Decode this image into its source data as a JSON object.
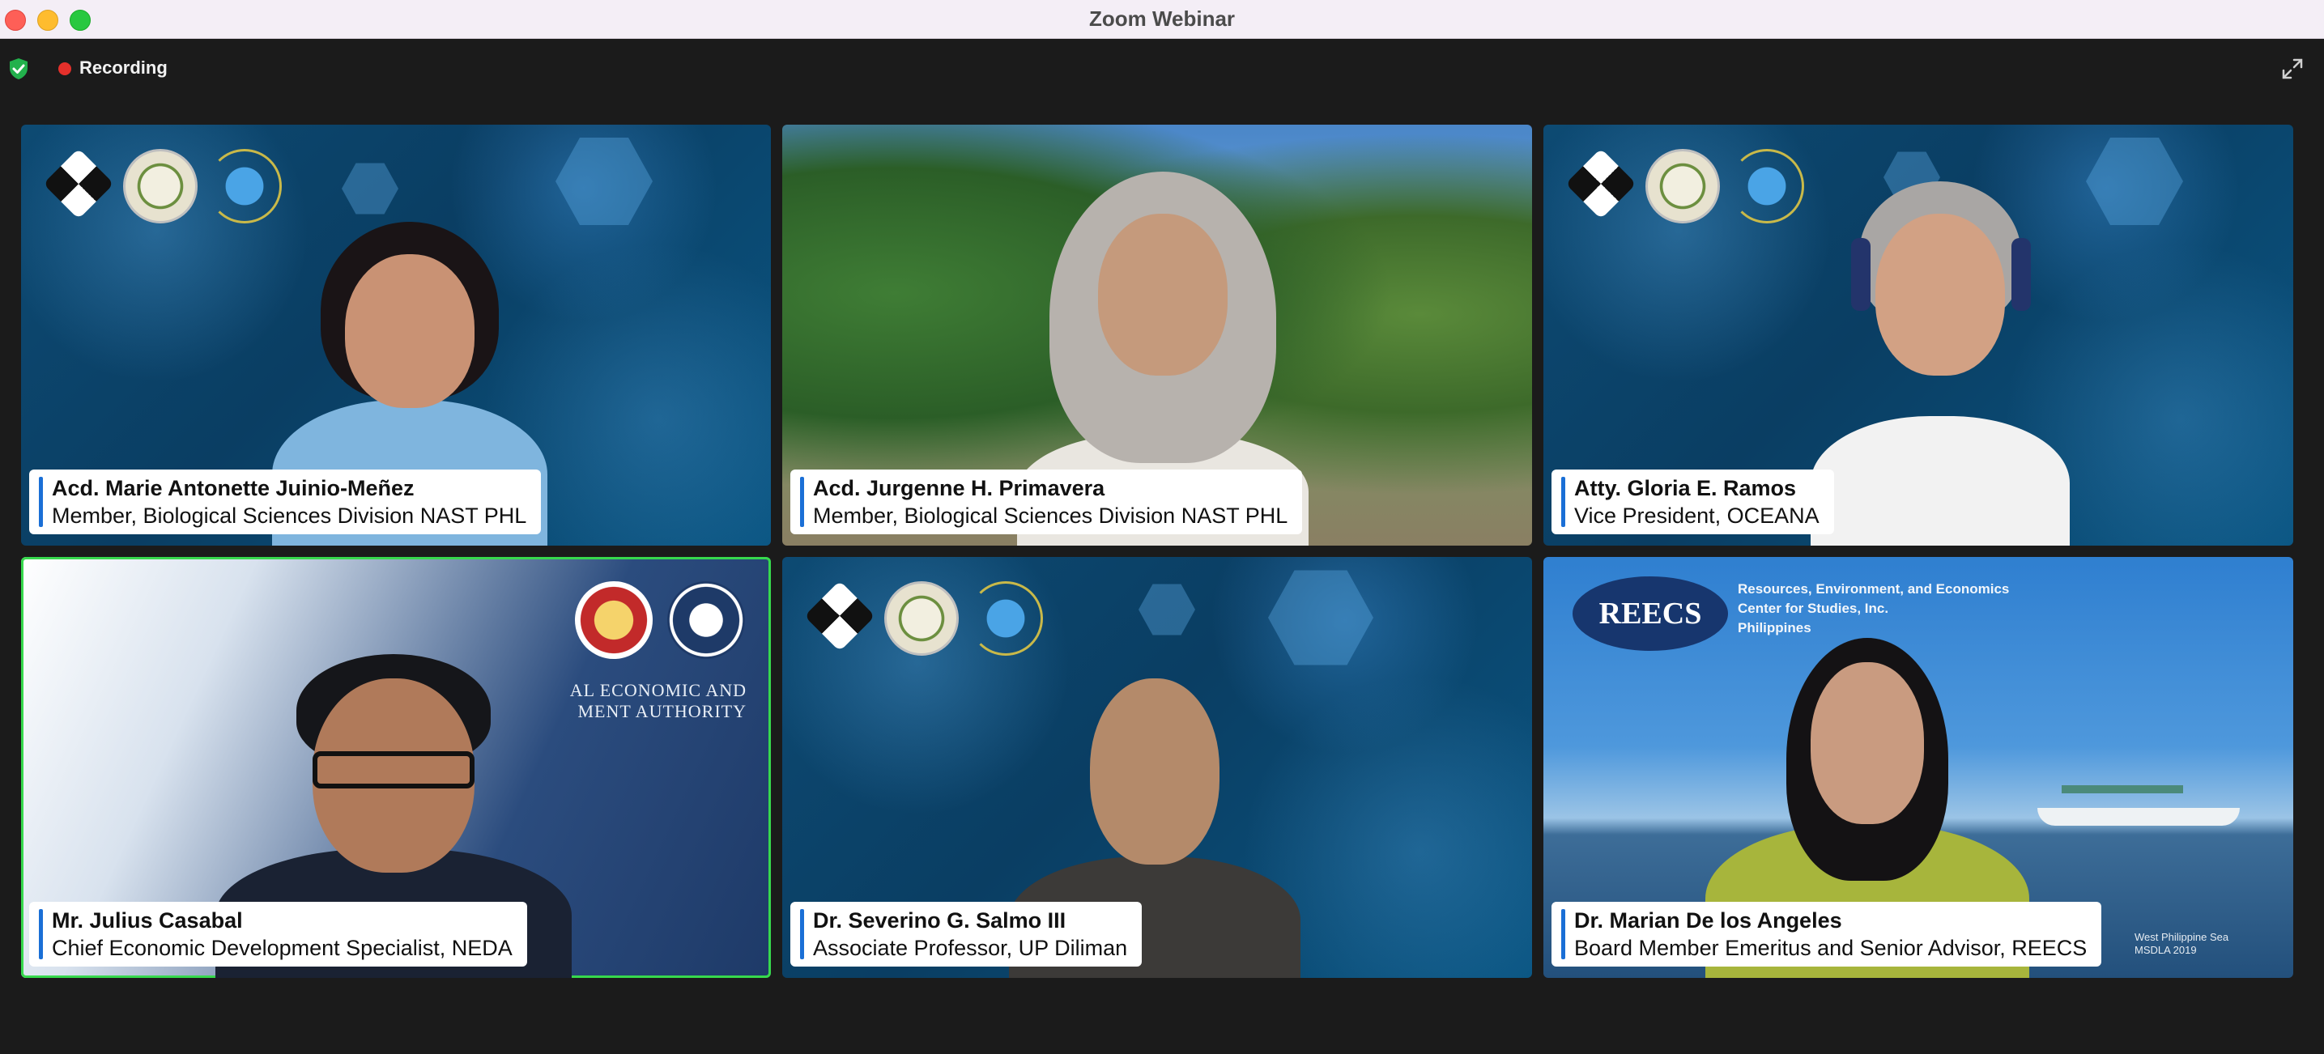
{
  "window": {
    "title": "Zoom Webinar"
  },
  "toolbar": {
    "recording_label": "Recording"
  },
  "participants": [
    {
      "name": "Acd. Marie Antonette Juinio-Meñez",
      "role": "Member, Biological Sciences Division NAST PHL"
    },
    {
      "name": "Acd. Jurgenne H. Primavera",
      "role": "Member, Biological Sciences Division NAST PHL"
    },
    {
      "name": "Atty. Gloria E. Ramos",
      "role": "Vice President, OCEANA"
    },
    {
      "name": "Mr. Julius Casabal",
      "role": "Chief Economic Development Specialist, NEDA"
    },
    {
      "name": "Dr. Severino G. Salmo III",
      "role": "Associate Professor, UP Diliman"
    },
    {
      "name": "Dr. Marian De los Angeles",
      "role": "Board Member Emeritus and Senior Advisor, REECS"
    }
  ],
  "backgrounds": {
    "neda_text_line1": "AL ECONOMIC AND",
    "neda_text_line2": "MENT AUTHORITY",
    "reecs_logo": "REECS",
    "reecs_line1": "Resources, Environment, and Economics",
    "reecs_line2": "Center for Studies, Inc.",
    "reecs_line3": "Philippines",
    "sea_caption1": "West Philippine Sea",
    "sea_caption2": "MSDLA 2019"
  },
  "colors": {
    "active_speaker_border": "#37d94d",
    "nametag_accent": "#1a6fd6",
    "recording_dot": "#e5302b"
  },
  "icons": [
    "shield-check-icon",
    "recording-dot-icon",
    "fullscreen-icon"
  ]
}
